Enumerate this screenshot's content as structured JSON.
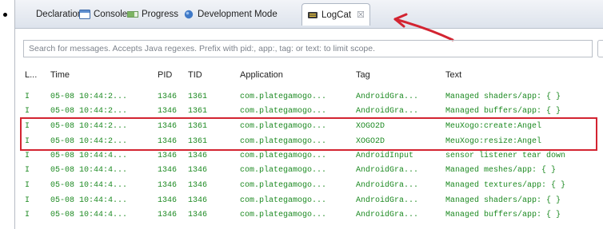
{
  "tabs": [
    {
      "label": "Declaration",
      "icon": "declaration-icon"
    },
    {
      "label": "Console",
      "icon": "console-icon"
    },
    {
      "label": "Progress",
      "icon": "progress-icon"
    },
    {
      "label": "Development Mode",
      "icon": "development-mode-icon"
    },
    {
      "label": "LogCat",
      "icon": "logcat-icon",
      "close_label": "☒"
    }
  ],
  "search": {
    "placeholder": "Search for messages. Accepts Java regexes. Prefix with pid:, app:, tag: or text: to limit scope."
  },
  "columns": [
    "L...",
    "Time",
    "PID",
    "TID",
    "Application",
    "Tag",
    "Text"
  ],
  "rows": [
    [
      "I",
      "05-08 10:44:2...",
      "1346",
      "1361",
      "com.plategamogo...",
      "AndroidGra...",
      "Managed shaders/app: { }"
    ],
    [
      "I",
      "05-08 10:44:2...",
      "1346",
      "1361",
      "com.plategamogo...",
      "AndroidGra...",
      "Managed buffers/app: { }"
    ],
    [
      "I",
      "05-08 10:44:2...",
      "1346",
      "1361",
      "com.plategamogo...",
      "XOGO2D",
      "MeuXogo:create:Angel"
    ],
    [
      "I",
      "05-08 10:44:2...",
      "1346",
      "1361",
      "com.plategamogo...",
      "XOGO2D",
      "MeuXogo:resize:Angel"
    ],
    [
      "I",
      "05-08 10:44:4...",
      "1346",
      "1346",
      "com.plategamogo...",
      "AndroidInput",
      "sensor listener tear down"
    ],
    [
      "I",
      "05-08 10:44:4...",
      "1346",
      "1346",
      "com.plategamogo...",
      "AndroidGra...",
      "Managed meshes/app: { }"
    ],
    [
      "I",
      "05-08 10:44:4...",
      "1346",
      "1346",
      "com.plategamogo...",
      "AndroidGra...",
      "Managed textures/app: { }"
    ],
    [
      "I",
      "05-08 10:44:4...",
      "1346",
      "1346",
      "com.plategamogo...",
      "AndroidGra...",
      "Managed shaders/app: { }"
    ],
    [
      "I",
      "05-08 10:44:4...",
      "1346",
      "1346",
      "com.plategamogo...",
      "AndroidGra...",
      "Managed buffers/app: { }"
    ]
  ],
  "colors": {
    "log_text": "#1d8a22",
    "highlight_box": "#d32431",
    "annotation_arrow": "#d32431"
  }
}
